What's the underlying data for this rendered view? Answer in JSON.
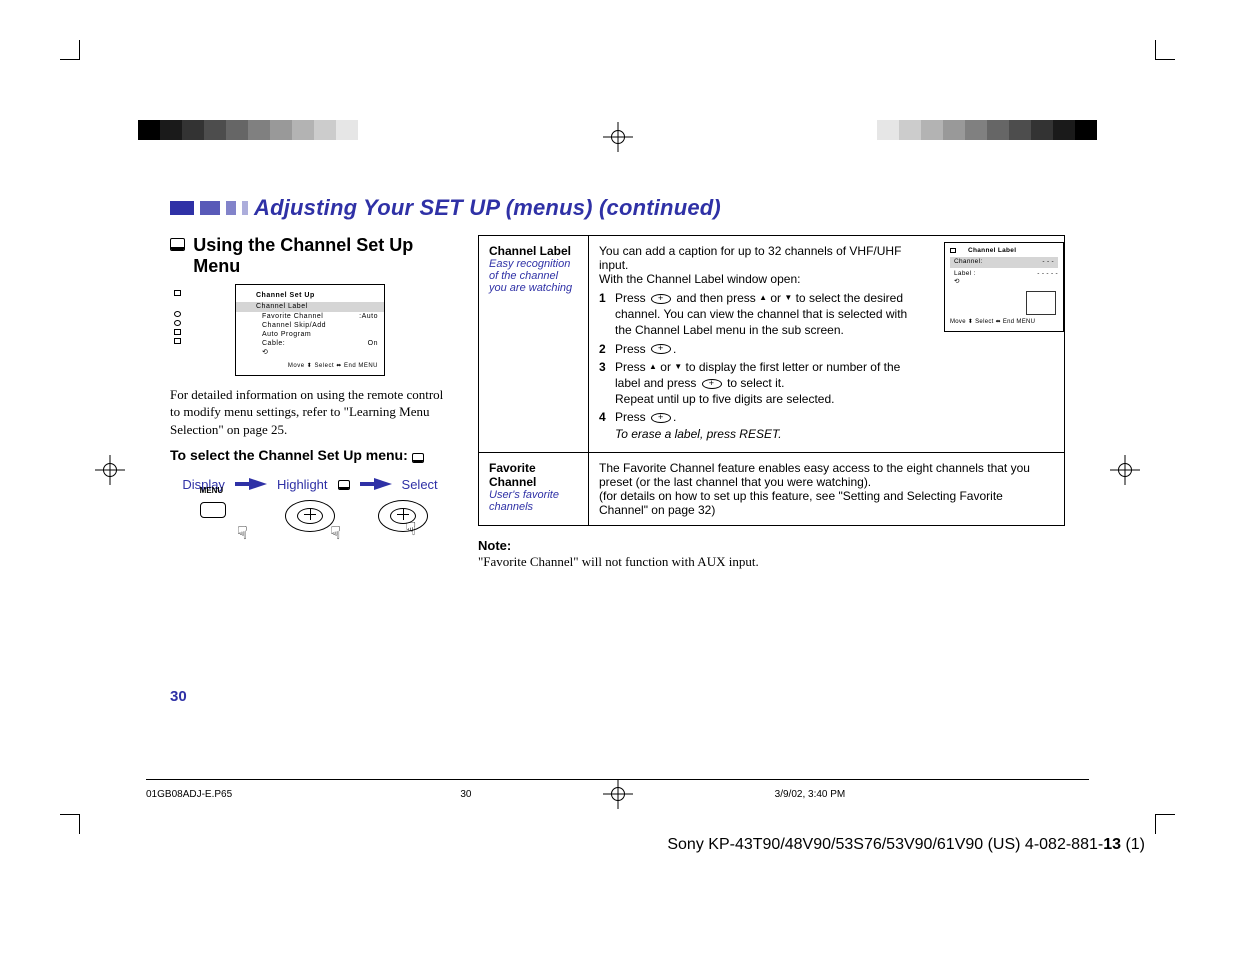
{
  "title": "Adjusting Your SET UP (menus) (continued)",
  "section_heading": "Using the Channel Set Up Menu",
  "osd": {
    "title": "Channel Set Up",
    "highlight": "Channel Label",
    "rows": [
      {
        "l": "Favorite Channel",
        "r": ":Auto"
      },
      {
        "l": "Channel Skip/Add",
        "r": ""
      },
      {
        "l": "Auto Program",
        "r": ""
      },
      {
        "l": "Cable:",
        "r": "On"
      }
    ],
    "footer": "Move ⬍   Select ⬌   End  MENU"
  },
  "intro": "For detailed information on using the remote control to modify menu settings, refer to \"Learning Menu Selection\" on page 25.",
  "select_heading": "To select the Channel Set Up      menu:",
  "flow": {
    "a": "Display",
    "b": "Highlight",
    "c": "Select"
  },
  "menu_label": "MENU",
  "table": {
    "row1": {
      "term": "Channel Label",
      "hint": "Easy recognition of the channel you are watching",
      "p1": "You can add a caption for up to 32 channels of VHF/UHF input.",
      "p2": "With the Channel Label window open:",
      "s1a": "Press ",
      "s1b": " and then press ",
      "s1c": " or ",
      "s1d": " to select the desired channel. You can view the channel that is selected with the Channel Label menu in the sub screen.",
      "s2a": "Press ",
      "s2b": ".",
      "s3a": "Press ",
      "s3b": " or ",
      "s3c": " to display the first letter or number of the label and press ",
      "s3d": " to select it.",
      "s3e": "Repeat until up to five digits are selected.",
      "s4a": "Press ",
      "s4b": ".",
      "erase": "To erase a label, press RESET.",
      "mini": {
        "title": "Channel Label",
        "hi_l": "Channel:",
        "hi_r": "- - -",
        "row_l": "Label    :",
        "row_r": "- - - - -",
        "foot": "Move ⬍   Select ⬌   End  MENU"
      }
    },
    "row2": {
      "term": "Favorite Channel",
      "hint": "User's favorite channels",
      "p1": "The Favorite Channel feature enables easy access to the eight channels that you preset (or the last channel that you were watching).",
      "p2": "(for details on how to set up this feature, see \"Setting and Selecting Favorite Channel\" on page 32)"
    }
  },
  "note_h": "Note:",
  "note_body": "\"Favorite Channel\" will not function with AUX input.",
  "page_number": "30",
  "footer": {
    "file": "01GB08ADJ-E.P65",
    "page": "30",
    "stamp": "3/9/02, 3:40 PM"
  },
  "doc_id_a": "Sony KP-43T90/48V90/53S76/53V90/61V90 (US) 4-082-881-",
  "doc_id_b": "13",
  "doc_id_c": " (1)",
  "grays": [
    "#000",
    "#1a1a1a",
    "#333",
    "#4d4d4d",
    "#666",
    "#808080",
    "#999",
    "#b3b3b3",
    "#ccc",
    "#e6e6e6",
    "#fff"
  ]
}
